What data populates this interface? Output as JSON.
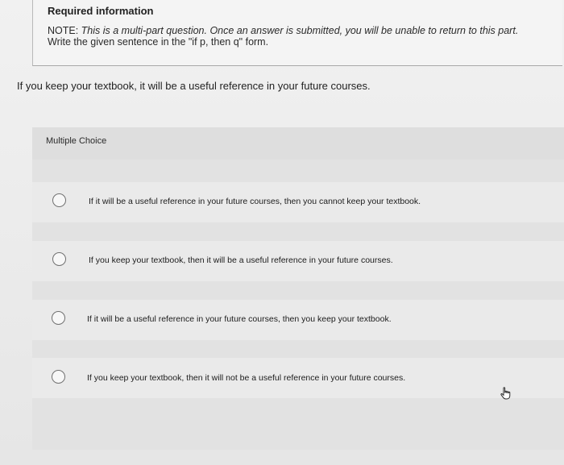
{
  "info": {
    "title": "Required information",
    "note_prefix": "NOTE: ",
    "note_italic": "This is a multi-part question. Once an answer is submitted, you will be unable to return to this part.",
    "instruction": "Write the given sentence in the \"if p, then q\" form."
  },
  "question": {
    "text": "If you keep your textbook, it will be a useful reference in your future courses."
  },
  "multiple_choice": {
    "label": "Multiple Choice",
    "choices": [
      {
        "text": "If it will be a useful reference in your future courses, then you cannot keep your textbook."
      },
      {
        "text": "If you keep your textbook, then it will be a useful reference in your future courses."
      },
      {
        "text": "If it will be a useful reference in your future courses, then you keep your textbook."
      },
      {
        "text": "If you keep your textbook, then it will not be a useful reference in your future courses."
      }
    ]
  },
  "icons": {
    "cursor": "hand-pointer-icon"
  }
}
